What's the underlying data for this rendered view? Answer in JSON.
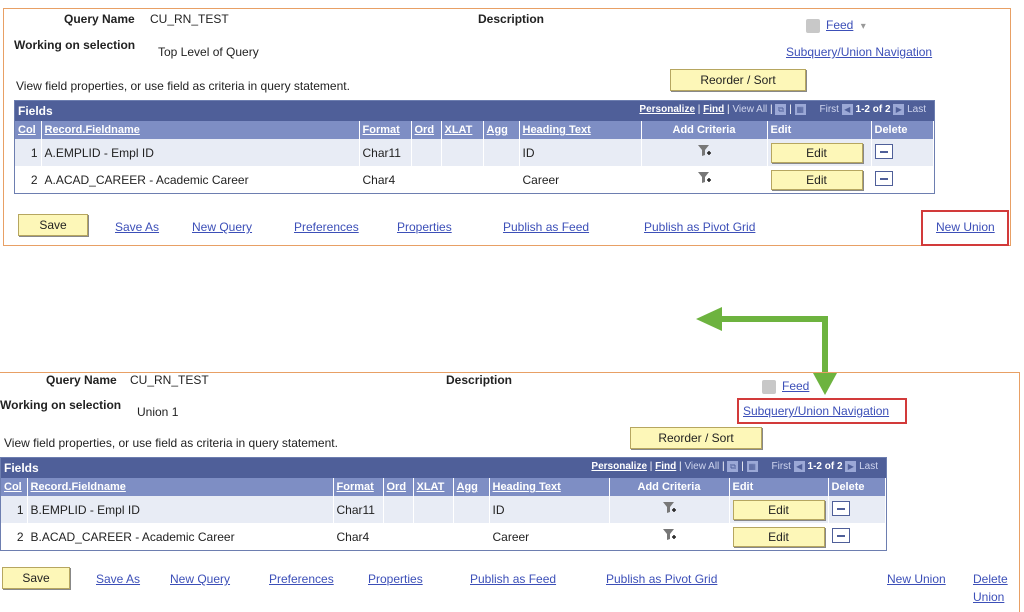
{
  "query_name_label": "Query Name",
  "description_label": "Description",
  "working_on_label": "Working on selection",
  "view_props_text": "View field properties, or use field as criteria in query statement.",
  "reorder_label": "Reorder / Sort",
  "feed_label": "Feed",
  "feed_caret": "▾",
  "subquery_nav_label": "Subquery/Union Navigation",
  "grid": {
    "title": "Fields",
    "personalize": "Personalize",
    "find": "Find",
    "view_all": "View All",
    "first": "First",
    "range": "1-2 of 2",
    "last": "Last",
    "columns": {
      "col": "Col",
      "record": "Record.Fieldname",
      "format": "Format",
      "ord": "Ord",
      "xlat": "XLAT",
      "agg": "Agg",
      "heading": "Heading Text",
      "add_criteria": "Add Criteria",
      "edit": "Edit",
      "delete": "Delete"
    }
  },
  "edit_label": "Edit",
  "actions": {
    "save": "Save",
    "save_as": "Save As",
    "new_query": "New Query",
    "preferences": "Preferences",
    "properties": "Properties",
    "publish_feed": "Publish as Feed",
    "publish_pivot": "Publish as Pivot Grid",
    "new_union": "New Union",
    "delete_union_1": "Delete",
    "delete_union_2": "Union"
  },
  "top": {
    "query_name": "CU_RN_TEST",
    "selection": "Top Level of Query",
    "rows": [
      {
        "col": "1",
        "record": "A.EMPLID - Empl ID",
        "format": "Char11",
        "heading": "ID"
      },
      {
        "col": "2",
        "record": "A.ACAD_CAREER - Academic Career",
        "format": "Char4",
        "heading": "Career"
      }
    ]
  },
  "bottom": {
    "query_name": "CU_RN_TEST",
    "selection": "Union 1",
    "rows": [
      {
        "col": "1",
        "record": "B.EMPLID - Empl ID",
        "format": "Char11",
        "heading": "ID"
      },
      {
        "col": "2",
        "record": "B.ACAD_CAREER - Academic Career",
        "format": "Char4",
        "heading": "Career"
      }
    ]
  },
  "colors": {
    "panel_border": "#e8a065",
    "grid_header": "#4f5f99",
    "col_header": "#7e8ec4",
    "button_fill": "#fdf7b8",
    "link": "#3c4fb8",
    "highlight": "#d23a3a",
    "arrow": "#6db33f"
  }
}
